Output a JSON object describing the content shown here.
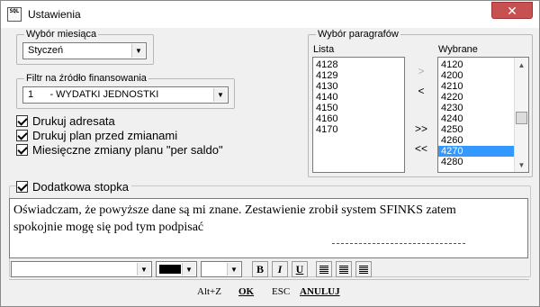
{
  "window": {
    "title": "Ustawienia",
    "icon_text": "SQL"
  },
  "month": {
    "legend": "Wybór miesiąca",
    "selected": "Styczeń"
  },
  "funding": {
    "legend": "Filtr na źródło finansowania",
    "selected": "1      - WYDATKI JEDNOSTKI"
  },
  "options": [
    {
      "label": "Drukuj adresata",
      "checked": true
    },
    {
      "label": "Drukuj plan przed zmianami",
      "checked": true
    },
    {
      "label": "Miesięczne zmiany planu \"per saldo\"",
      "checked": true
    }
  ],
  "paragraphs": {
    "legend": "Wybór paragrafów",
    "list_label": "Lista",
    "selected_label": "Wybrane",
    "list_items": [
      "4128",
      "4129",
      "4130",
      "4140",
      "4150",
      "4160",
      "4170"
    ],
    "selected_items": [
      "4120",
      "4200",
      "4210",
      "4220",
      "4230",
      "4240",
      "4250",
      "4260",
      "4270",
      "4280"
    ],
    "highlighted": "4270",
    "move_buttons": [
      ">",
      "<",
      ">>",
      "<<"
    ]
  },
  "footer_option": {
    "label": "Dodatkowa stopka",
    "checked": true
  },
  "memo": {
    "line1": "Oświadczam,  że powyższe dane są mi znane. Zestawienie zrobił system SFINKS zatem",
    "line2": "spokojnie mogę się pod tym podpisać"
  },
  "format_bar": {
    "bold": "B",
    "italic": "I",
    "underline": "U",
    "text_color": "#000000"
  },
  "buttons": {
    "ok_shortcut": "Alt+Z",
    "ok": "OK",
    "cancel_shortcut": "ESC",
    "cancel": "ANULUJ"
  },
  "colors": {
    "selection": "#3399ff",
    "close": "#c75050"
  }
}
